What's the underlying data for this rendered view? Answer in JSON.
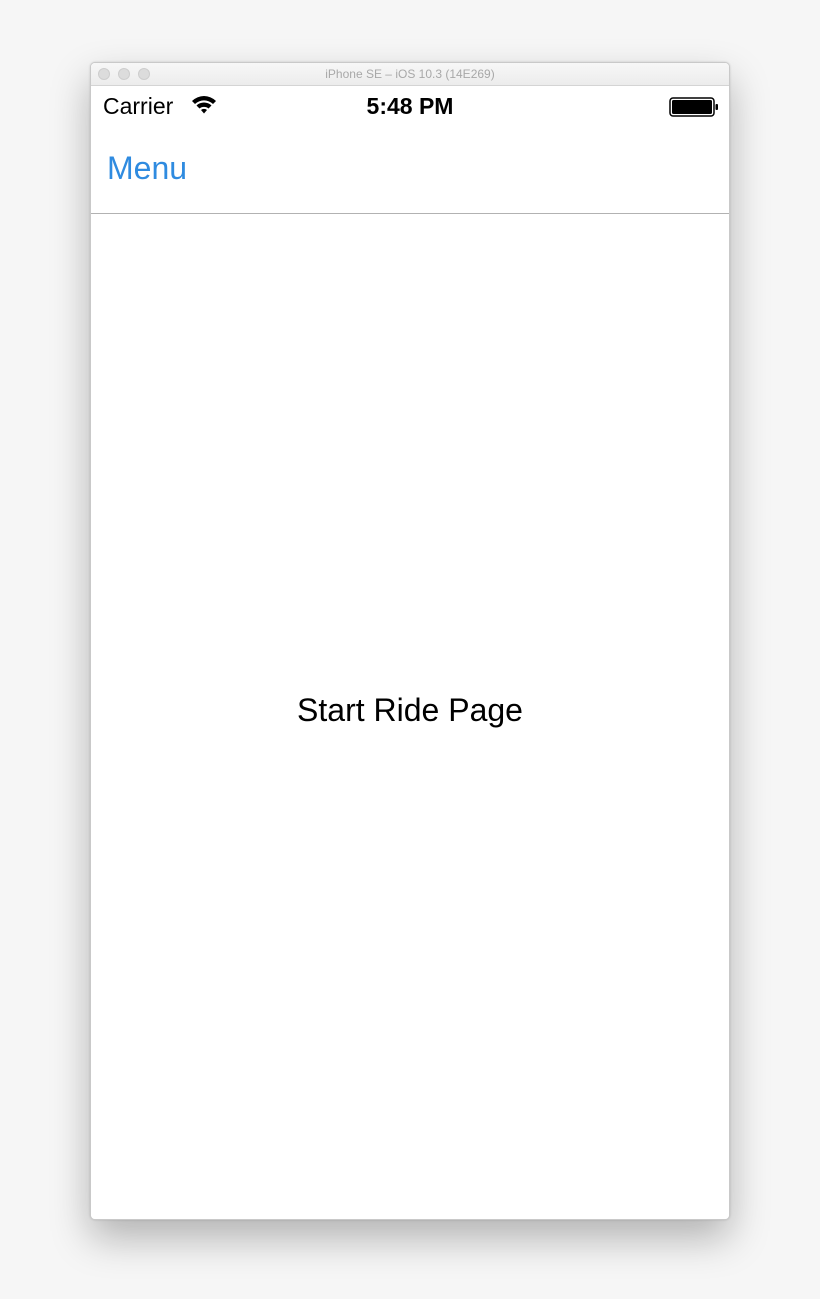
{
  "window": {
    "title": "iPhone SE – iOS 10.3 (14E269)"
  },
  "status_bar": {
    "carrier": "Carrier",
    "time": "5:48 PM",
    "wifi_icon": "wifi-icon",
    "battery_icon": "battery-icon",
    "battery_level": 1.0
  },
  "nav_bar": {
    "menu_label": "Menu",
    "accent_color": "#2f8be0"
  },
  "content": {
    "label": "Start Ride Page"
  }
}
